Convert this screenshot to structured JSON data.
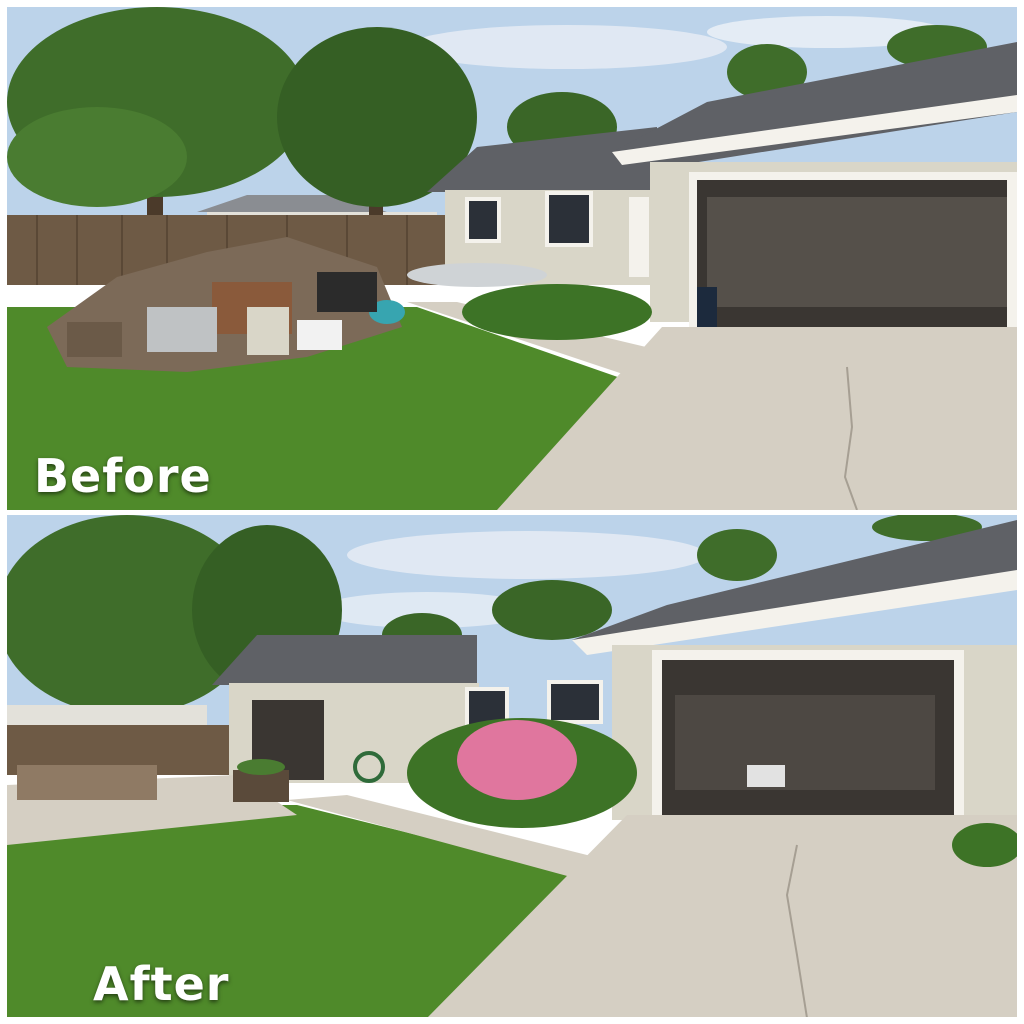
{
  "panels": {
    "before": {
      "label": "Before"
    },
    "after": {
      "label": "After"
    }
  },
  "colors": {
    "sky": "#bcd3ea",
    "grass": "#4f8a2a",
    "siding": "#d9d6c8",
    "roof": "#5f6166",
    "concrete": "#d5cfc3",
    "fence": "#6e5a45",
    "trim": "#f4f2ec"
  }
}
